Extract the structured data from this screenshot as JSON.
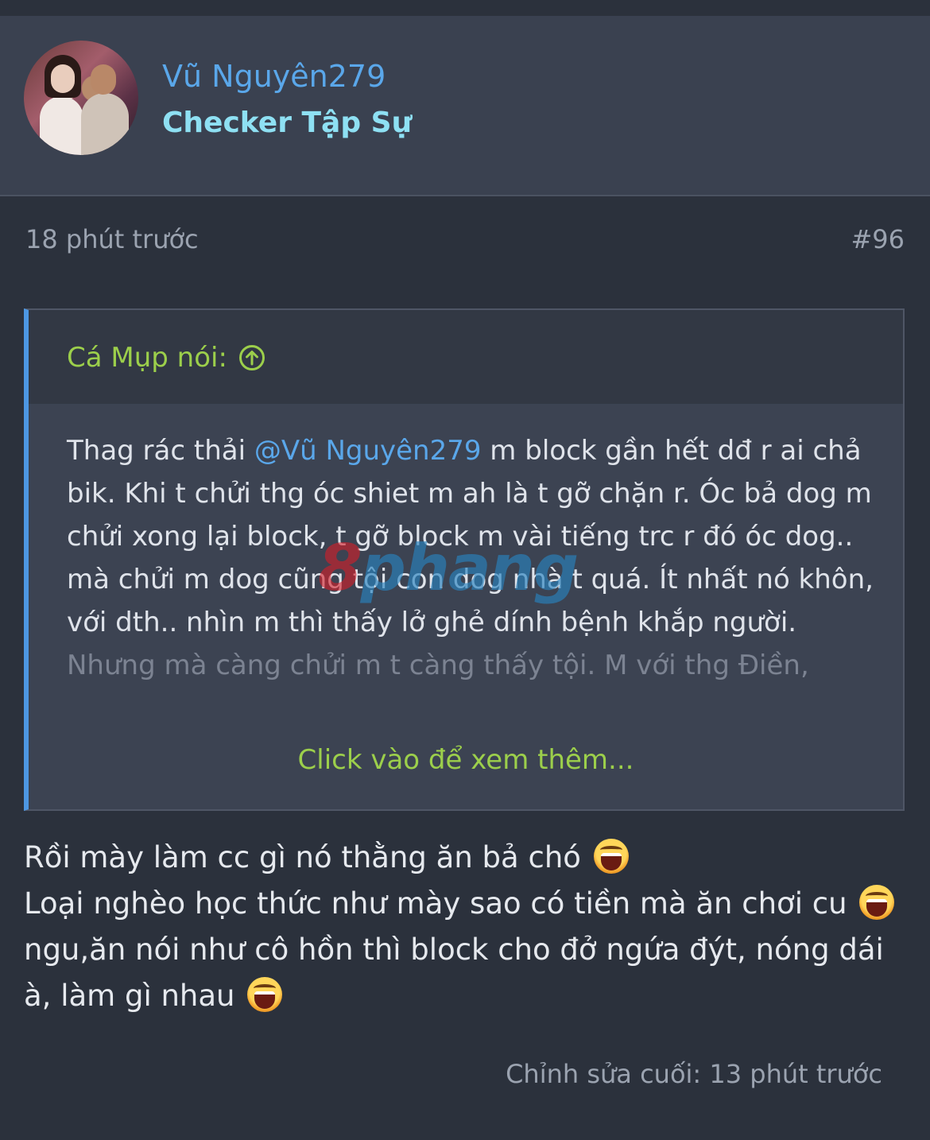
{
  "post": {
    "username": "Vũ Nguyên279",
    "user_title": "Checker Tập Sự",
    "timestamp": "18 phút trước",
    "post_number": "#96",
    "edited_label": "Chỉnh sửa cuối: 13 phút trước"
  },
  "quote": {
    "author_label": "Cá Mụp nói:",
    "text_before_mention": "Thag rác thải ",
    "mention": "@Vũ Nguyên279",
    "text_after_mention": " m block gần hết dđ r ai chả bik. Khi t chửi thg óc shiet m ah là t gỡ chặn r. Óc bả dog m chửi xong lại block, t gỡ block m vài tiếng trc r đó óc dog.. mà chửi m dog cũng tội con dog nhà t quá. Ít nhất nó khôn, với dth.. nhìn m thì thấy lở ghẻ dính bệnh khắp người.",
    "faded_line": "Nhưng mà càng chửi m t càng thấy tội. M với thg Điền,",
    "expand_label": "Click vào để xem thêm..."
  },
  "watermark": {
    "part1": "8",
    "part2": "phang"
  },
  "message": {
    "line1": "Rồi mày làm cc gì nó thằng ăn bả chó",
    "line2": "Loại nghèo học thức như mày sao có tiền mà ăn chơi cu",
    "line3": "ngu,ăn nói như cô hồn thì block cho đở ngứa đýt, nóng dái à, làm gì nhau"
  },
  "icons": {
    "quote_arrow": "arrow-up-circle-icon",
    "emoji": "laughing-face-emoji"
  },
  "colors": {
    "background": "#2b313c",
    "username": "#5aa7ea",
    "user_title": "#8ee0f3",
    "quote_accent": "#4d97e3",
    "quote_author": "#9ccf4b"
  }
}
